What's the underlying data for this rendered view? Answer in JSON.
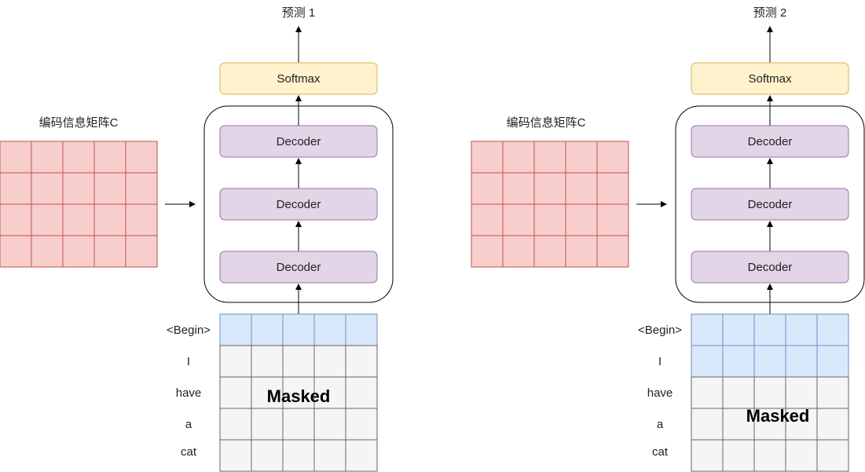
{
  "panels": [
    {
      "prediction_label": "预测 1",
      "softmax_label": "Softmax",
      "decoders": [
        "Decoder",
        "Decoder",
        "Decoder"
      ],
      "encoding_label": "编码信息矩阵C",
      "tokens": [
        "<Begin>",
        "I",
        "have",
        "a",
        "cat"
      ],
      "visible_rows": 1,
      "masked_label": "Masked"
    },
    {
      "prediction_label": "预测 2",
      "softmax_label": "Softmax",
      "decoders": [
        "Decoder",
        "Decoder",
        "Decoder"
      ],
      "encoding_label": "编码信息矩阵C",
      "tokens": [
        "<Begin>",
        "I",
        "have",
        "a",
        "cat"
      ],
      "visible_rows": 2,
      "masked_label": "Masked"
    }
  ],
  "colors": {
    "encoding_fill": "#f8cecc",
    "encoding_stroke": "#b85450",
    "softmax_fill": "#fff2cc",
    "softmax_stroke": "#d6b656",
    "decoder_fill": "#e1d5e7",
    "decoder_stroke": "#9673a6",
    "visible_fill": "#dae8fc",
    "visible_stroke": "#6c8ebf",
    "masked_fill": "#f5f5f5",
    "masked_stroke": "#666666"
  }
}
